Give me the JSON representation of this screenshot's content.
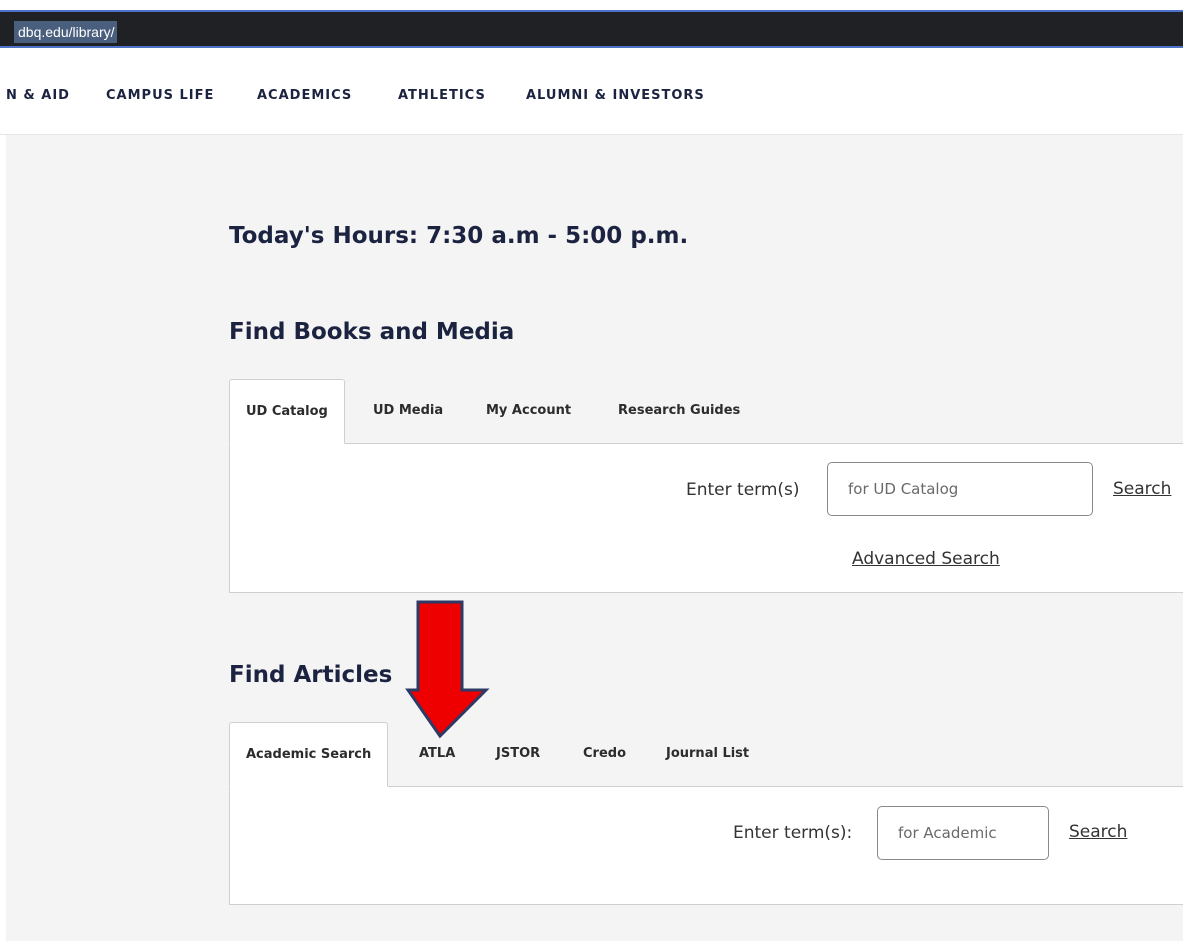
{
  "address_bar": {
    "url": "dbq.edu/library/"
  },
  "site_nav": {
    "items": [
      "N & AID",
      "CAMPUS LIFE",
      "ACADEMICS",
      "ATHLETICS",
      "ALUMNI & INVESTORS"
    ]
  },
  "hours": {
    "text": "Today's Hours: 7:30 a.m - 5:00 p.m."
  },
  "books": {
    "title": "Find Books and Media",
    "tabs": [
      {
        "label": "UD Catalog",
        "active": true
      },
      {
        "label": "UD Media",
        "active": false
      },
      {
        "label": "My Account",
        "active": false
      },
      {
        "label": "Research Guides",
        "active": false
      }
    ],
    "field_label": "Enter term(s)",
    "placeholder": "for UD Catalog",
    "search_label": "Search",
    "advanced_label": "Advanced Search"
  },
  "articles": {
    "title": "Find Articles",
    "tabs": [
      {
        "label": "Academic Search",
        "active": true
      },
      {
        "label": "ATLA",
        "active": false
      },
      {
        "label": "JSTOR",
        "active": false
      },
      {
        "label": "Credo",
        "active": false
      },
      {
        "label": "Journal List",
        "active": false
      }
    ],
    "field_label": "Enter term(s):",
    "placeholder": "for Academic",
    "search_label": "Search"
  },
  "colors": {
    "nav_text": "#1b2340",
    "arrow_fill": "#ee0000",
    "arrow_outline": "#2d3a66",
    "content_bg": "#f4f4f4"
  },
  "annotation": {
    "arrow_icon": "red-down-arrow-icon"
  }
}
